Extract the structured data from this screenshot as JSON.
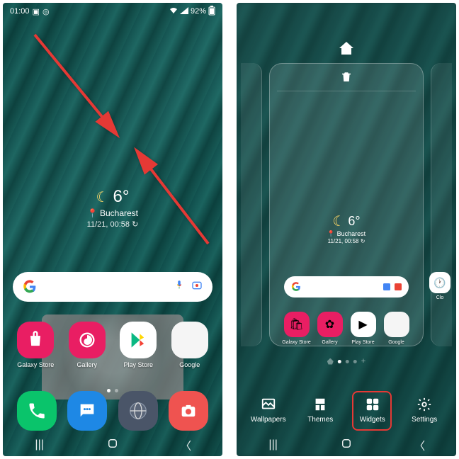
{
  "statusbar": {
    "time": "01:00",
    "battery": "92%"
  },
  "weather": {
    "temp": "6°",
    "city": "Bucharest",
    "datetime": "11/21, 00:58"
  },
  "apps": {
    "galaxy_store": "Galaxy Store",
    "gallery": "Gallery",
    "play_store": "Play Store",
    "google": "Google",
    "clock": "Clo"
  },
  "editbar": {
    "wallpapers": "Wallpapers",
    "themes": "Themes",
    "widgets": "Widgets",
    "settings": "Settings"
  }
}
